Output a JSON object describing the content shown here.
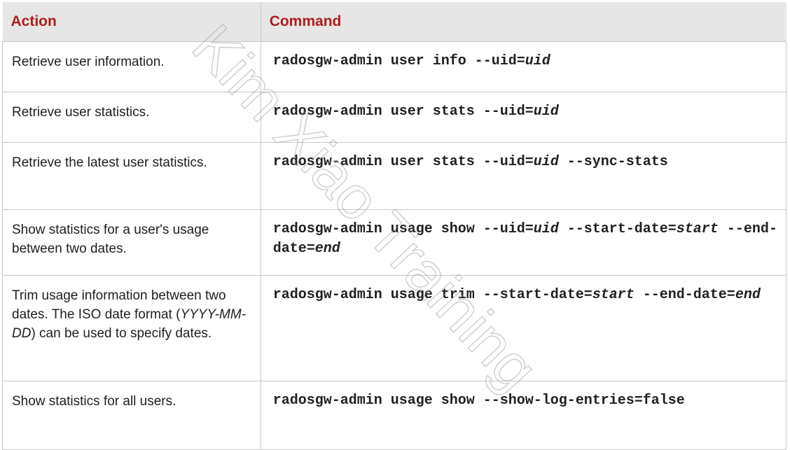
{
  "table": {
    "headers": {
      "action": "Action",
      "command": "Command"
    },
    "rows": [
      {
        "action": "Retrieve user information.",
        "command": [
          {
            "text": "radosgw-admin user info --uid="
          },
          {
            "text": "uid",
            "italic": true
          }
        ]
      },
      {
        "action": "Retrieve user statistics.",
        "command": [
          {
            "text": "radosgw-admin user stats --uid="
          },
          {
            "text": "uid",
            "italic": true
          }
        ]
      },
      {
        "action": "Retrieve the latest user statistics.",
        "command": [
          {
            "text": "radosgw-admin user stats --uid="
          },
          {
            "text": "uid",
            "italic": true
          },
          {
            "text": " --sync-stats"
          }
        ]
      },
      {
        "action": "Show statistics for a user's usage between two dates.",
        "command": [
          {
            "text": "radosgw-admin usage show --uid="
          },
          {
            "text": "uid",
            "italic": true
          },
          {
            "text": " --start-date="
          },
          {
            "text": "start",
            "italic": true
          },
          {
            "text": " --end-date="
          },
          {
            "text": "end",
            "italic": true
          }
        ]
      },
      {
        "action": [
          {
            "text": "Trim usage information between two dates. The ISO date format ("
          },
          {
            "text": "YYYY-MM-DD",
            "italic": true
          },
          {
            "text": ") can be used to specify dates."
          }
        ],
        "command": [
          {
            "text": "radosgw-admin usage trim --start-date="
          },
          {
            "text": "start",
            "italic": true
          },
          {
            "text": " --end-date="
          },
          {
            "text": "end",
            "italic": true
          }
        ]
      },
      {
        "action": "Show statistics for all users.",
        "command": [
          {
            "text": "radosgw-admin usage show --show-log-entries=false"
          }
        ]
      }
    ]
  },
  "watermark": {
    "text": "Kim Xiao Training"
  },
  "colors": {
    "header_text": "#b01c1c",
    "header_bg": "#e6e6e6",
    "border": "#c8c8c8"
  }
}
